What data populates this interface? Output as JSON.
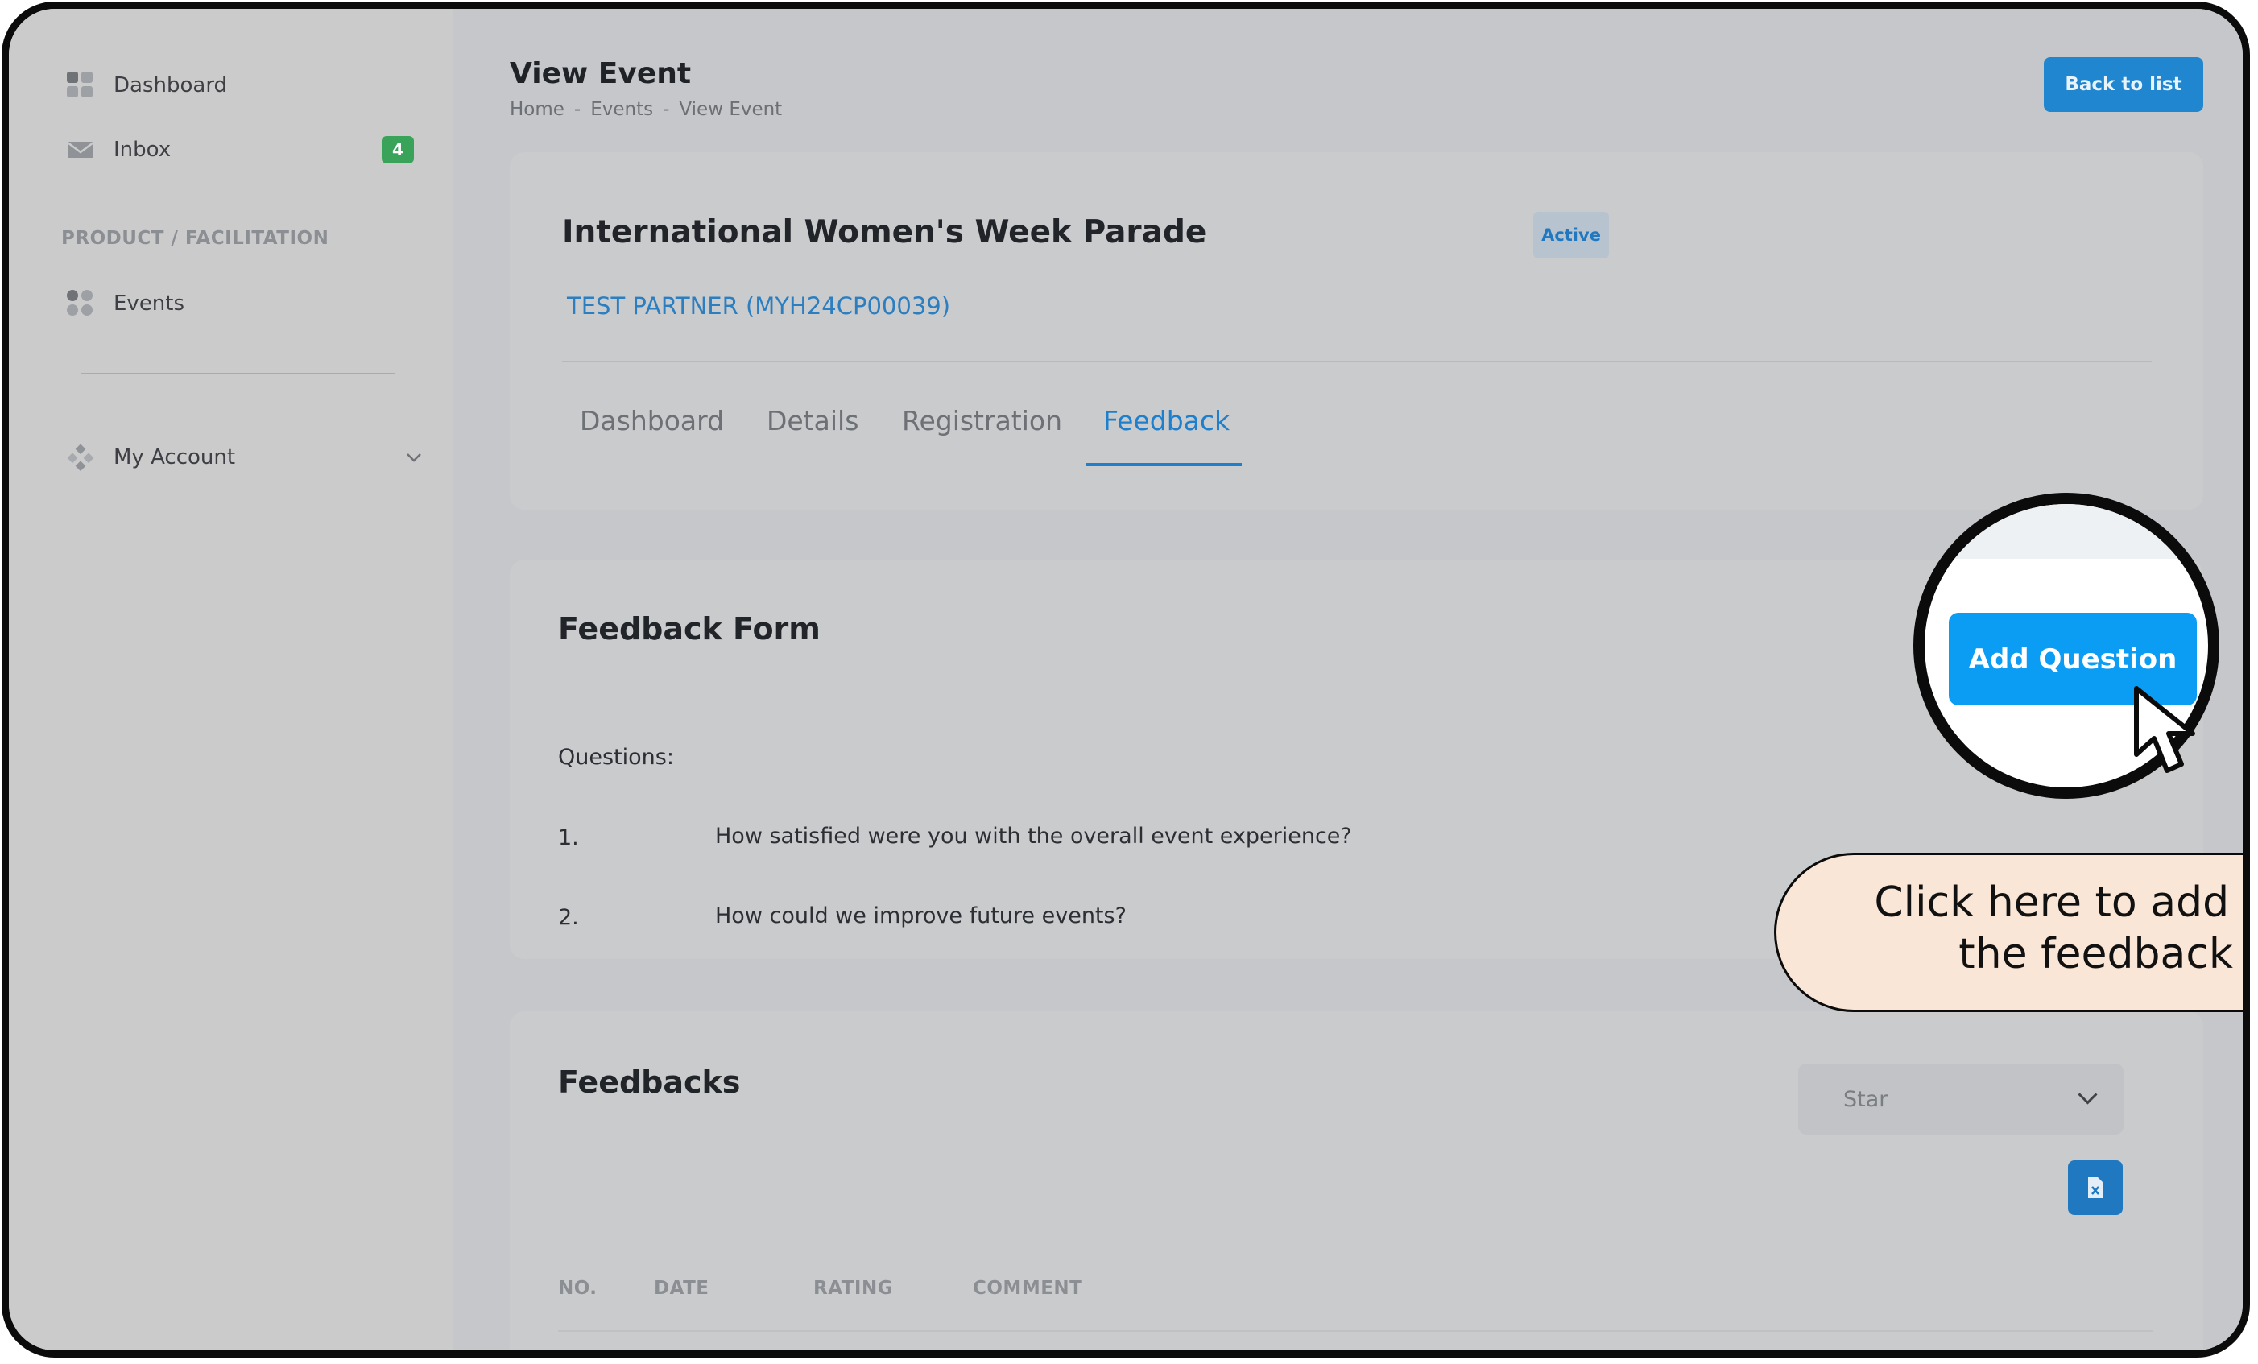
{
  "sidebar": {
    "items": [
      {
        "label": "Dashboard",
        "icon": "dashboard-icon"
      },
      {
        "label": "Inbox",
        "icon": "inbox-icon",
        "badge": "4"
      },
      {
        "label": "Events",
        "icon": "events-icon"
      },
      {
        "label": "My Account",
        "icon": "account-icon"
      }
    ],
    "section_label": "PRODUCT / FACILITATION"
  },
  "header": {
    "title": "View Event",
    "breadcrumb": [
      "Home",
      "-",
      "Events",
      "-",
      "View Event"
    ],
    "back_button": "Back to list"
  },
  "event": {
    "title": "International Women's Week Parade",
    "status": "Active",
    "partner": "TEST PARTNER (MYH24CP00039)"
  },
  "tabs": [
    {
      "label": "Dashboard",
      "active": false
    },
    {
      "label": "Details",
      "active": false
    },
    {
      "label": "Registration",
      "active": false
    },
    {
      "label": "Feedback",
      "active": true
    }
  ],
  "feedback_form": {
    "title": "Feedback Form",
    "add_button": "Add Question",
    "questions_label": "Questions:",
    "questions": [
      {
        "num": "1.",
        "text": "How satisfied were you with the overall event experience?"
      },
      {
        "num": "2.",
        "text": "How could we improve future events?"
      }
    ]
  },
  "feedbacks": {
    "title": "Feedbacks",
    "filter_value": "Star",
    "columns": [
      "NO.",
      "DATE",
      "RATING",
      "COMMENT"
    ]
  },
  "tooltip": {
    "line1": "Click here to add que",
    "line2": "the feedback fo"
  },
  "colors": {
    "accent": "#1e7fcc",
    "primary_button": "#0b9cf3",
    "badge": "#3aa35a",
    "tooltip_bg": "#fae6d6"
  }
}
